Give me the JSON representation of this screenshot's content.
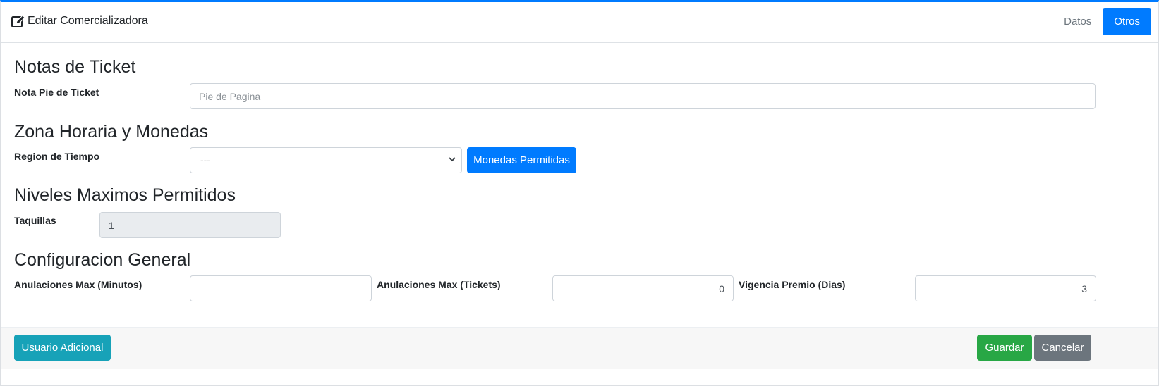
{
  "header": {
    "title": "Editar Comercializadora",
    "tabs": [
      {
        "label": "Datos",
        "active": false
      },
      {
        "label": "Otros",
        "active": true
      }
    ]
  },
  "sections": {
    "notas": {
      "title": "Notas de Ticket",
      "nota_label": "Nota Pie de Ticket",
      "nota_placeholder": "Pie de Pagina",
      "nota_value": ""
    },
    "zona": {
      "title": "Zona Horaria y Monedas",
      "region_label": "Region de Tiempo",
      "region_selected": "---",
      "monedas_button": "Monedas Permitidas"
    },
    "niveles": {
      "title": "Niveles Maximos Permitidos",
      "taquillas_label": "Taquillas",
      "taquillas_value": "1"
    },
    "config": {
      "title": "Configuracion General",
      "anul_min_label": "Anulaciones Max (Minutos)",
      "anul_min_value": "",
      "anul_tickets_label": "Anulaciones Max (Tickets)",
      "anul_tickets_value": "0",
      "vigencia_label": "Vigencia Premio (Dias)",
      "vigencia_value": "3"
    }
  },
  "footer": {
    "usuario_adicional": "Usuario Adicional",
    "guardar": "Guardar",
    "cancelar": "Cancelar"
  },
  "colors": {
    "primary": "#007bff",
    "info": "#17a2b8",
    "success": "#28a745",
    "secondary": "#6c757d"
  },
  "icons": {
    "title_icon": "edit-icon",
    "select_icon": "chevron-down-icon"
  }
}
